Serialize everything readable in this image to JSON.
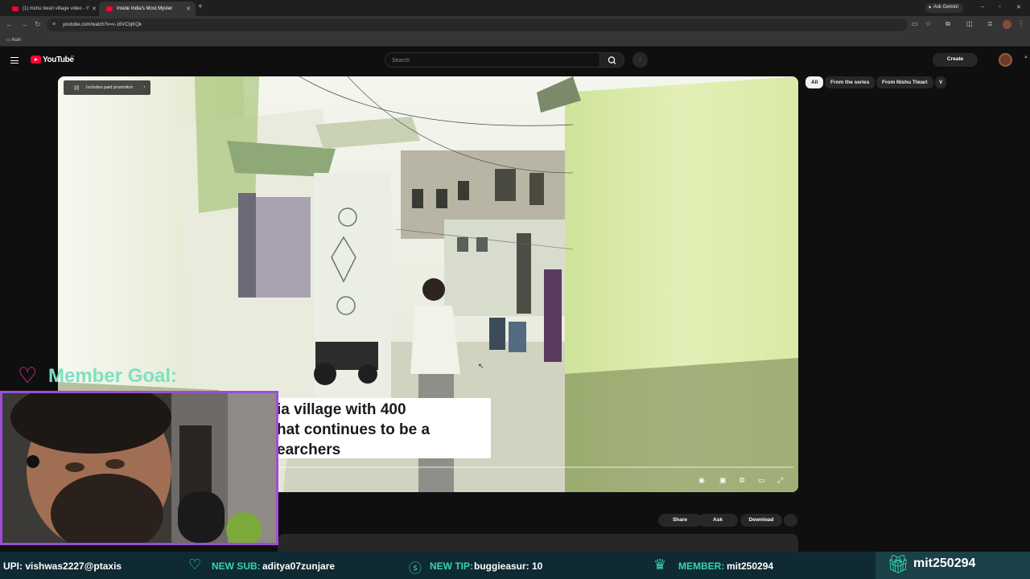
{
  "browser": {
    "tabs": [
      {
        "title": "(1) nishu tiwari village video - Y",
        "active": false
      },
      {
        "title": "Inside India's Most Myster",
        "active": true
      }
    ],
    "ask_gemini": "Ask Gemini",
    "url": "youtube.com/watch?v=v-16VCbjKQk",
    "bookmarks": [
      {
        "label": "Acer"
      }
    ]
  },
  "youtube": {
    "logo": "YouTube",
    "logo_sup": "IN",
    "search_placeholder": "Search",
    "create": "Create"
  },
  "player": {
    "paid_promotion": "Includes paid promotion",
    "caption": "ia village with 400\nhat continues to be a\nearchers"
  },
  "actions": {
    "share": "Share",
    "ask": "Ask",
    "download": "Download"
  },
  "chips": [
    {
      "label": "All",
      "active": true
    },
    {
      "label": "From the series",
      "active": false
    },
    {
      "label": "From Nishu Tiwari",
      "active": false
    },
    {
      "label": "V",
      "active": false
    }
  ],
  "overlay": {
    "member_goal": "Member Goal:",
    "upi": "UPI: vishwas2227@ptaxis",
    "new_sub_label": "NEW SUB:",
    "new_sub_value": "aditya07zunjare",
    "new_tip_label": "NEW TIP:",
    "new_tip_value": "buggieasur: 10",
    "member_label": "MEMBER:",
    "member_value": "mit250294",
    "gift_user": "mit250294"
  },
  "colors": {
    "accent_teal": "#35d6a8",
    "webcam_border": "#9a4fd6",
    "heart": "#ff3b9a",
    "youtube_red": "#ff0033"
  }
}
